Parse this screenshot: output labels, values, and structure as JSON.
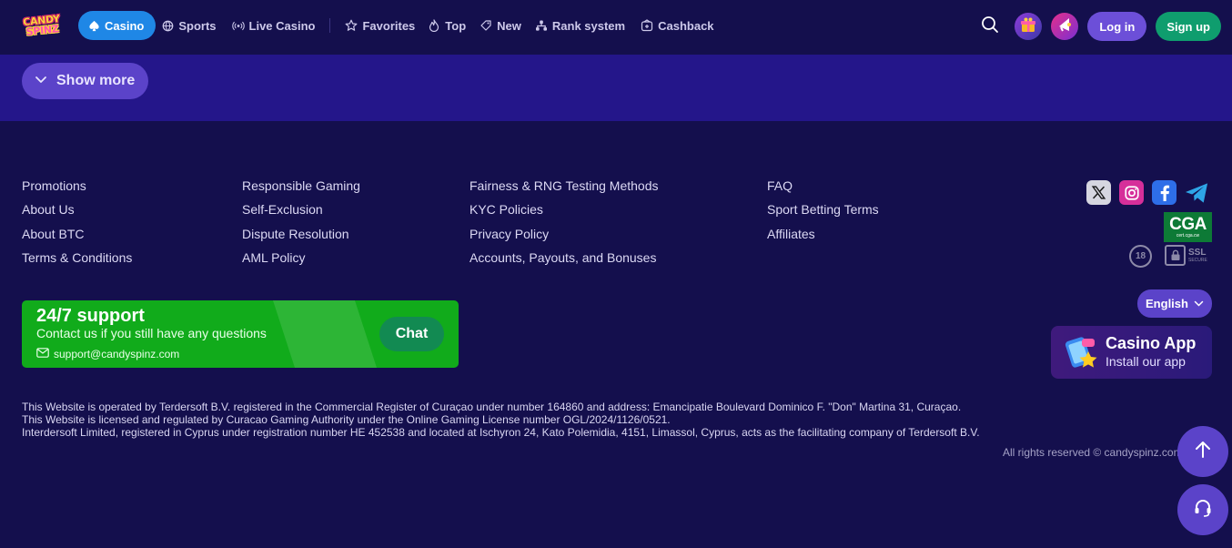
{
  "header": {
    "logo": {
      "line1": "CANDY",
      "line2": "SPINZ"
    },
    "nav": [
      {
        "label": "Casino",
        "icon": "spade-icon",
        "active": true
      },
      {
        "label": "Sports",
        "icon": "ball-icon"
      },
      {
        "label": "Live Casino",
        "icon": "broadcast-icon"
      },
      {
        "label": "Favorites",
        "icon": "star-icon"
      },
      {
        "label": "Top",
        "icon": "fire-icon"
      },
      {
        "label": "New",
        "icon": "new-icon"
      },
      {
        "label": "Rank system",
        "icon": "rank-icon"
      },
      {
        "label": "Cashback",
        "icon": "cashback-icon"
      }
    ],
    "login_label": "Log in",
    "signup_label": "Sign up"
  },
  "show_more_label": "Show more",
  "footer": {
    "columns": [
      [
        "Promotions",
        "About Us",
        "About BTC",
        "Terms & Conditions"
      ],
      [
        "Responsible Gaming",
        "Self-Exclusion",
        "Dispute Resolution",
        "AML Policy"
      ],
      [
        "Fairness & RNG Testing Methods",
        "KYC Policies",
        "Privacy Policy",
        "Accounts, Payouts, and Bonuses"
      ],
      [
        "FAQ",
        "Sport Betting Terms",
        "Affiliates"
      ]
    ],
    "badges": {
      "cga": "CGA",
      "cga_sub": "cert.cga.cw",
      "age": "18",
      "ssl": "SSL",
      "ssl_sub": "SECURE"
    }
  },
  "support": {
    "title": "24/7 support",
    "subtitle": "Contact us if you still have any questions",
    "email": "support@candyspinz.com",
    "chat_label": "Chat"
  },
  "language": "English",
  "app": {
    "title": "Casino App",
    "subtitle": "Install our app"
  },
  "legal": [
    "This Website is operated by Terdersoft B.V. registered in the Commercial Register of Curaçao under number 164860 and address: Emancipatie Boulevard Dominico F. \"Don\" Martina 31, Curaçao.",
    "This Website is licensed and regulated by Curacao Gaming Authority under the Online Gaming License number OGL/2024/1126/0521.",
    "Interdersoft Limited, registered in Cyprus under registration number HE 452538 and located at Ischyron 24, Kato Polemidia, 4151, Limassol, Cyprus, acts as the facilitating company of Terdersoft B.V."
  ],
  "rights": "All rights reserved © candyspinz.com",
  "colors": {
    "bg": "#140f4d",
    "band": "#24168a",
    "accent": "#5b43c9",
    "support": "#11ab1b",
    "signup": "#0f9d6e"
  }
}
